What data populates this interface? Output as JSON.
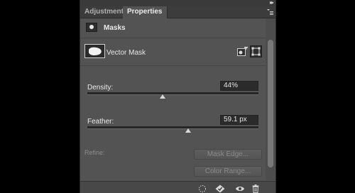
{
  "tabs": [
    {
      "label": "Adjustments",
      "active": false
    },
    {
      "label": "Properties",
      "active": true
    }
  ],
  "icons": {
    "collapse": "double-chevron-right-icon",
    "panel_menu": "panel-menu-icon",
    "masks": "pixel-mask-icon",
    "add_mask": "add-pixel-mask-icon",
    "select_vector_mask": "select-vector-mask-icon",
    "footer": [
      "load-selection-icon",
      "apply-mask-icon",
      "visibility-eye-icon",
      "trash-icon"
    ]
  },
  "section": {
    "title": "Masks"
  },
  "vector_mask": {
    "label": "Vector Mask"
  },
  "density": {
    "label": "Density:",
    "value": "44%",
    "slider_fraction": 0.44
  },
  "feather": {
    "label": "Feather:",
    "value": "59.1 px",
    "slider_fraction": 0.59
  },
  "refine": {
    "label": "Refine:",
    "mask_edge_button": "Mask Edge...",
    "color_range_button": "Color Range..."
  },
  "colors": {
    "panel_bg": "#535353",
    "tabbar_bg": "#3c3c3c",
    "field_bg": "#2b2b2b",
    "disabled_text": "#8a8a8a"
  }
}
